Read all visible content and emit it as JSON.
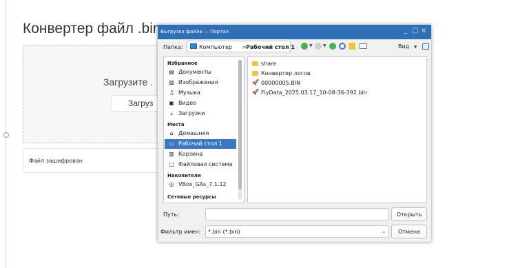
{
  "page": {
    "title": "Конвертер файл .bin",
    "upload_prompt": "Загрузите .",
    "upload_button": "Загруз",
    "encrypted_label": "Файл зашифрован"
  },
  "dialog": {
    "title": "Выгрузка файла — Портал",
    "window_controls": [
      "_",
      "□",
      "×"
    ],
    "folder_label": "Папка:",
    "breadcrumb": [
      "Компьютер",
      "Рабочий стол 1"
    ],
    "view_label": "Вид",
    "sidebar": {
      "sections": [
        {
          "title": "Избранное",
          "items": [
            {
              "icon": "document-icon",
              "glyph": "▤",
              "label": "Документы"
            },
            {
              "icon": "image-icon",
              "glyph": "▨",
              "label": "Изображения"
            },
            {
              "icon": "music-icon",
              "glyph": "♫",
              "label": "Музыка"
            },
            {
              "icon": "video-icon",
              "glyph": "▣",
              "label": "Видео"
            },
            {
              "icon": "download-icon",
              "glyph": "⤓",
              "label": "Загрузки"
            }
          ]
        },
        {
          "title": "Места",
          "items": [
            {
              "icon": "home-icon",
              "glyph": "⌂",
              "label": "Домашняя"
            },
            {
              "icon": "desktop-icon",
              "glyph": "▭",
              "label": "Рабочий стол 1",
              "selected": true
            },
            {
              "icon": "trash-icon",
              "glyph": "▥",
              "label": "Корзина"
            },
            {
              "icon": "drive-icon",
              "glyph": "▢",
              "label": "Файловая система"
            }
          ]
        },
        {
          "title": "Накопители",
          "items": [
            {
              "icon": "disc-icon",
              "glyph": "◎",
              "label": "VBox_GAs_7.1.12"
            }
          ]
        },
        {
          "title": "Сетевые ресурсы",
          "items": []
        }
      ]
    },
    "files": [
      {
        "type": "folder",
        "icon": "folder-icon",
        "name": "share"
      },
      {
        "type": "folder",
        "icon": "folder-icon",
        "name": "Конвертер логов"
      },
      {
        "type": "file",
        "icon": "rocket-icon",
        "name": "00000005.BIN"
      },
      {
        "type": "file",
        "icon": "rocket-icon",
        "name": "FlyData_2025.03.17_10-08-36-392.bin"
      }
    ],
    "path_label": "Путь:",
    "path_value": "",
    "open_button": "Открыть",
    "filter_label": "Фильтр имен:",
    "filter_value": "*.bin (*.bin)",
    "cancel_button": "Отмена"
  },
  "colors": {
    "titlebar": "#2f6fb6",
    "selection": "#3a78c3",
    "folder": "#f3c23f"
  }
}
